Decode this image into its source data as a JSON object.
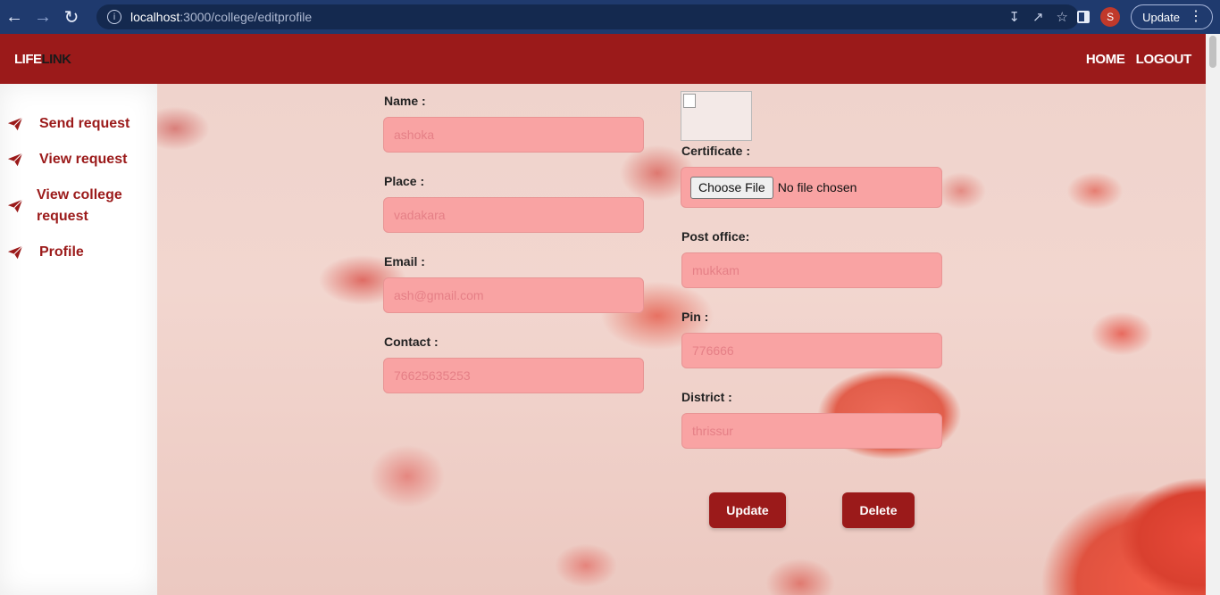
{
  "browser": {
    "url_host": "localhost",
    "url_path": ":3000/college/editprofile",
    "profile_initial": "S",
    "update_label": "Update"
  },
  "header": {
    "logo_part1": "LIFE",
    "logo_part2": "LINK",
    "nav": [
      "HOME",
      "LOGOUT"
    ]
  },
  "sidebar": {
    "items": [
      {
        "label": "Send request"
      },
      {
        "label": "View request"
      },
      {
        "label_line1": "View college",
        "label_line2": "request"
      },
      {
        "label": "Profile"
      }
    ]
  },
  "form": {
    "name": {
      "label": "Name :",
      "placeholder": "ashoka"
    },
    "place": {
      "label": "Place :",
      "placeholder": "vadakara"
    },
    "email": {
      "label": "Email :",
      "placeholder": "ash@gmail.com"
    },
    "contact": {
      "label": "Contact :",
      "placeholder": "76625635253"
    },
    "certificate": {
      "label": "Certificate :",
      "button": "Choose File",
      "status": "No file chosen"
    },
    "post_office": {
      "label": "Post office:",
      "placeholder": "mukkam"
    },
    "pin": {
      "label": "Pin :",
      "placeholder": "776666"
    },
    "district": {
      "label": "District :",
      "placeholder": "thrissur"
    },
    "update_button": "Update",
    "delete_button": "Delete"
  },
  "colors": {
    "brand": "#9b1a1a",
    "field_bg": "#f9a3a3",
    "placeholder": "#e57f86"
  }
}
